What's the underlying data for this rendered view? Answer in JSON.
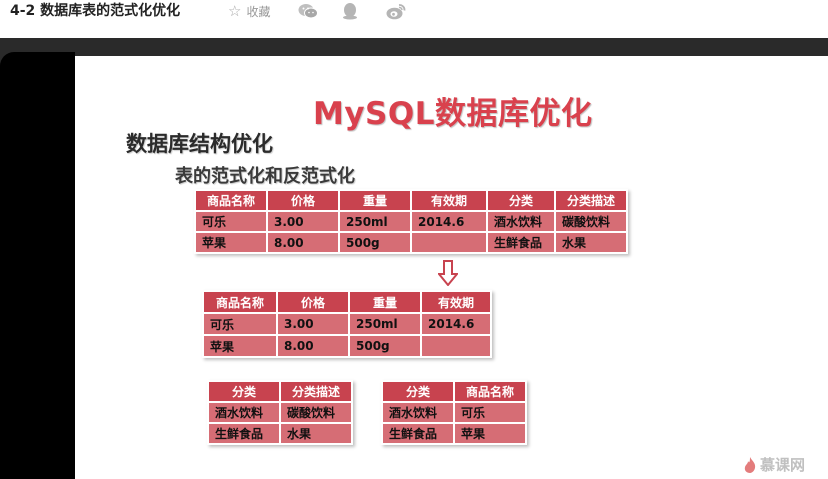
{
  "header": {
    "title": "4-2 数据库表的范式化优化",
    "favorite_label": "收藏"
  },
  "slide": {
    "title": "MySQL数据库优化",
    "heading": "数据库结构优化",
    "subheading": "表的范式化和反范式化",
    "main_table": {
      "headers": [
        "商品名称",
        "价格",
        "重量",
        "有效期",
        "分类",
        "分类描述"
      ],
      "rows": [
        [
          "可乐",
          "3.00",
          "250ml",
          "2014.6",
          "酒水饮料",
          "碳酸饮料"
        ],
        [
          "苹果",
          "8.00",
          "500g",
          "",
          "生鲜食品",
          "水果"
        ]
      ]
    },
    "product_table": {
      "headers": [
        "商品名称",
        "价格",
        "重量",
        "有效期"
      ],
      "rows": [
        [
          "可乐",
          "3.00",
          "250ml",
          "2014.6"
        ],
        [
          "苹果",
          "8.00",
          "500g",
          ""
        ]
      ]
    },
    "category_table": {
      "headers": [
        "分类",
        "分类描述"
      ],
      "rows": [
        [
          "酒水饮料",
          "碳酸饮料"
        ],
        [
          "生鲜食品",
          "水果"
        ]
      ]
    },
    "relation_table": {
      "headers": [
        "分类",
        "商品名称"
      ],
      "rows": [
        [
          "酒水饮料",
          "可乐"
        ],
        [
          "生鲜食品",
          "苹果"
        ]
      ]
    }
  },
  "watermark": {
    "text": "慕课网"
  },
  "icons": [
    "star-icon",
    "wechat-icon",
    "qq-icon",
    "weibo-icon",
    "down-arrow-icon",
    "flame-icon"
  ],
  "colors": {
    "slide_title": "#d9414d",
    "header_cell": "#c8434f",
    "data_cell": "#d66d75"
  }
}
